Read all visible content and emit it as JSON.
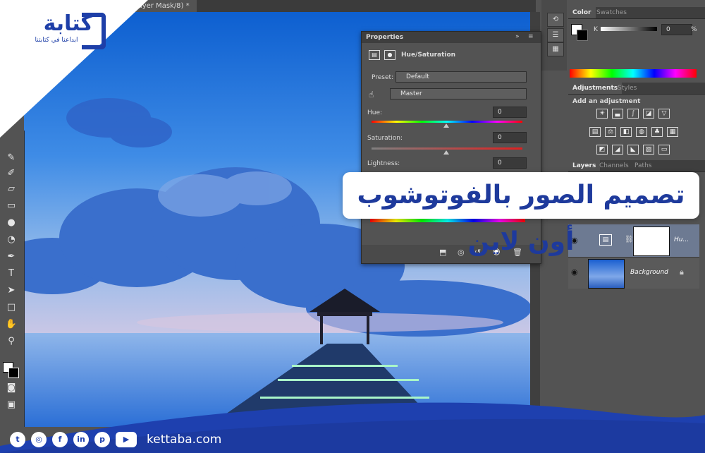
{
  "document_tab": "Layer Mask/8) *",
  "toolbar_icons": [
    "brush-icon",
    "history-brush-icon",
    "eraser-icon",
    "gradient-icon",
    "blur-icon",
    "dodge-icon",
    "pen-icon",
    "type-icon",
    "path-select-icon",
    "shape-icon",
    "hand-icon",
    "zoom-icon"
  ],
  "color_panel": {
    "tabs": [
      "Color",
      "Swatches"
    ],
    "channel_label": "K",
    "value": "0",
    "unit": "%"
  },
  "adjustments_panel": {
    "tabs": [
      "Adjustments",
      "Styles"
    ],
    "heading": "Add an adjustment"
  },
  "layers_panel": {
    "tabs": [
      "Layers",
      "Channels",
      "Paths"
    ],
    "layers": [
      {
        "name": "Hu...",
        "type": "adjustment"
      },
      {
        "name": "Background",
        "type": "image"
      }
    ]
  },
  "properties_panel": {
    "title": "Properties",
    "mode": "Hue/Saturation",
    "preset_label": "Preset:",
    "preset_value": "Default",
    "channel_value": "Master",
    "hue_label": "Hue:",
    "hue_value": "0",
    "saturation_label": "Saturation:",
    "saturation_value": "0",
    "lightness_label": "Lightness:",
    "lightness_value": "0"
  },
  "overlay": {
    "title": "تصميم الصور بالفوتوشوب أون لاين",
    "logo_text": "كتابة",
    "logo_subtitle": "ابداعنا في كتابتنا",
    "website": "kettaba.com",
    "social": [
      {
        "name": "twitter",
        "glyph": "t"
      },
      {
        "name": "instagram",
        "glyph": "◎"
      },
      {
        "name": "facebook",
        "glyph": "f"
      },
      {
        "name": "linkedin",
        "glyph": "in"
      },
      {
        "name": "pinterest",
        "glyph": "p"
      },
      {
        "name": "youtube",
        "glyph": "▶"
      }
    ]
  },
  "colors": {
    "brand": "#1e40af",
    "accent": "#2563eb",
    "ps_panel": "#535353"
  }
}
